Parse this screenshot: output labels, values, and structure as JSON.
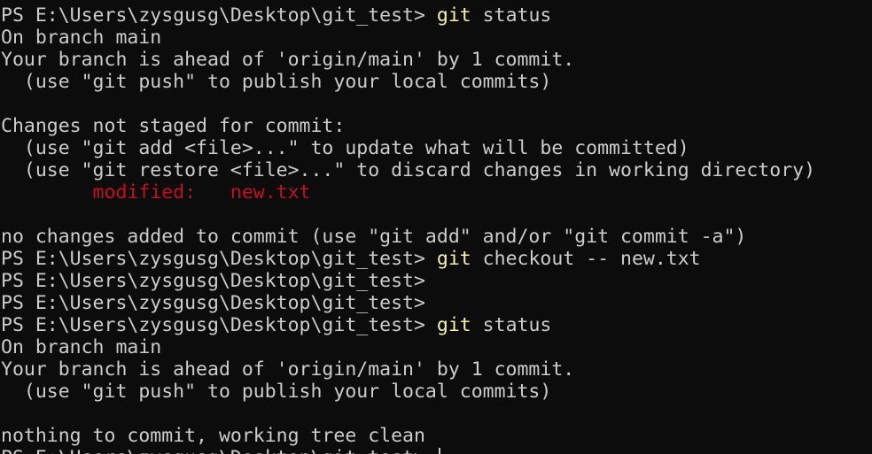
{
  "terminal": {
    "colors": {
      "background": "#0c0c0c",
      "text": "#cccccc",
      "command": "#f9f1a5",
      "modified": "#c50f1f"
    },
    "lines": [
      {
        "prompt": "PS E:\\Users\\zysgusg\\Desktop\\git_test> ",
        "cmd": "git",
        "args": " status"
      },
      {
        "text": "On branch main"
      },
      {
        "text": "Your branch is ahead of 'origin/main' by 1 commit."
      },
      {
        "text": "  (use \"git push\" to publish your local commits)"
      },
      {
        "text": ""
      },
      {
        "text": "Changes not staged for commit:"
      },
      {
        "text": "  (use \"git add <file>...\" to update what will be committed)"
      },
      {
        "text": "  (use \"git restore <file>...\" to discard changes in working directory)"
      },
      {
        "modified": "        modified:   new.txt"
      },
      {
        "text": ""
      },
      {
        "text": "no changes added to commit (use \"git add\" and/or \"git commit -a\")"
      },
      {
        "prompt": "PS E:\\Users\\zysgusg\\Desktop\\git_test> ",
        "cmd": "git",
        "args": " checkout -- new.txt"
      },
      {
        "prompt": "PS E:\\Users\\zysgusg\\Desktop\\git_test>"
      },
      {
        "prompt": "PS E:\\Users\\zysgusg\\Desktop\\git_test>"
      },
      {
        "prompt": "PS E:\\Users\\zysgusg\\Desktop\\git_test> ",
        "cmd": "git",
        "args": " status"
      },
      {
        "text": "On branch main"
      },
      {
        "text": "Your branch is ahead of 'origin/main' by 1 commit."
      },
      {
        "text": "  (use \"git push\" to publish your local commits)"
      },
      {
        "text": ""
      },
      {
        "text": "nothing to commit, working tree clean"
      },
      {
        "prompt": "PS E:\\Users\\zysgusg\\Desktop\\git_test> ",
        "cursor": true
      }
    ]
  }
}
